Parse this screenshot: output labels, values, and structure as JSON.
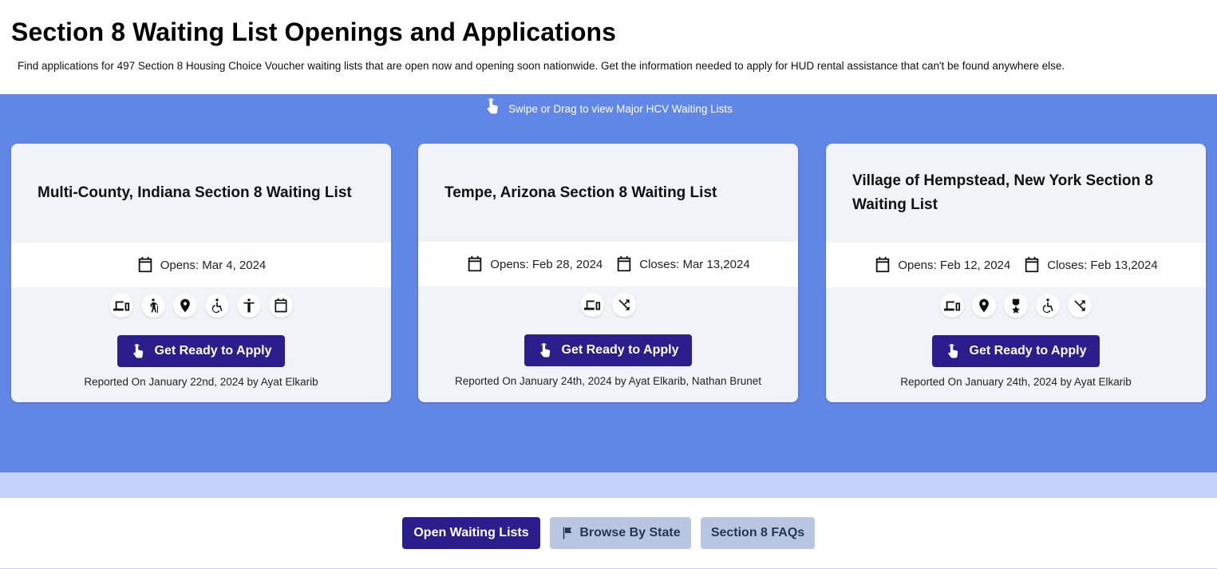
{
  "header": {
    "title": "Section 8 Waiting List Openings and Applications",
    "subtitle": "Find applications for 497 Section 8 Housing Choice Voucher waiting lists that are open now and opening soon nationwide. Get the information needed to apply for HUD rental assistance that can't be found anywhere else."
  },
  "carousel": {
    "hint": "Swipe or Drag to view Major HCV Waiting Lists",
    "cards": [
      {
        "title": "Multi-County, Indiana Section 8 Waiting List",
        "opens": "Opens: Mar 4, 2024",
        "closes": "",
        "features": [
          "online-icon",
          "elderly-icon",
          "location-icon",
          "disabled-icon",
          "person-icon",
          "calendar-icon"
        ],
        "button_label": "Get Ready to Apply",
        "reported": "Reported On January 22nd, 2024 by Ayat Elkarib"
      },
      {
        "title": "Tempe, Arizona Section 8 Waiting List",
        "opens": "Opens: Feb 28, 2024",
        "closes": "Closes: Mar 13,2024",
        "features": [
          "online-icon",
          "lottery-icon"
        ],
        "button_label": "Get Ready to Apply",
        "reported": "Reported On January 24th, 2024 by Ayat Elkarib, Nathan Brunet"
      },
      {
        "title": "Village of Hempstead, New York Section 8 Waiting List",
        "opens": "Opens: Feb 12, 2024",
        "closes": "Closes: Feb 13,2024",
        "features": [
          "online-icon",
          "location-icon",
          "veteran-icon",
          "disabled-icon",
          "lottery-icon"
        ],
        "button_label": "Get Ready to Apply",
        "reported": "Reported On January 24th, 2024 by Ayat Elkarib"
      }
    ]
  },
  "nav": {
    "open_lists": "Open Waiting Lists",
    "browse_state": "Browse By State",
    "faqs": "Section 8 FAQs"
  },
  "colors": {
    "carousel_bg": "#6187e6",
    "button_primary": "#2b1e8c",
    "button_secondary": "#b8c6e2",
    "band": "#c5d3fb"
  }
}
